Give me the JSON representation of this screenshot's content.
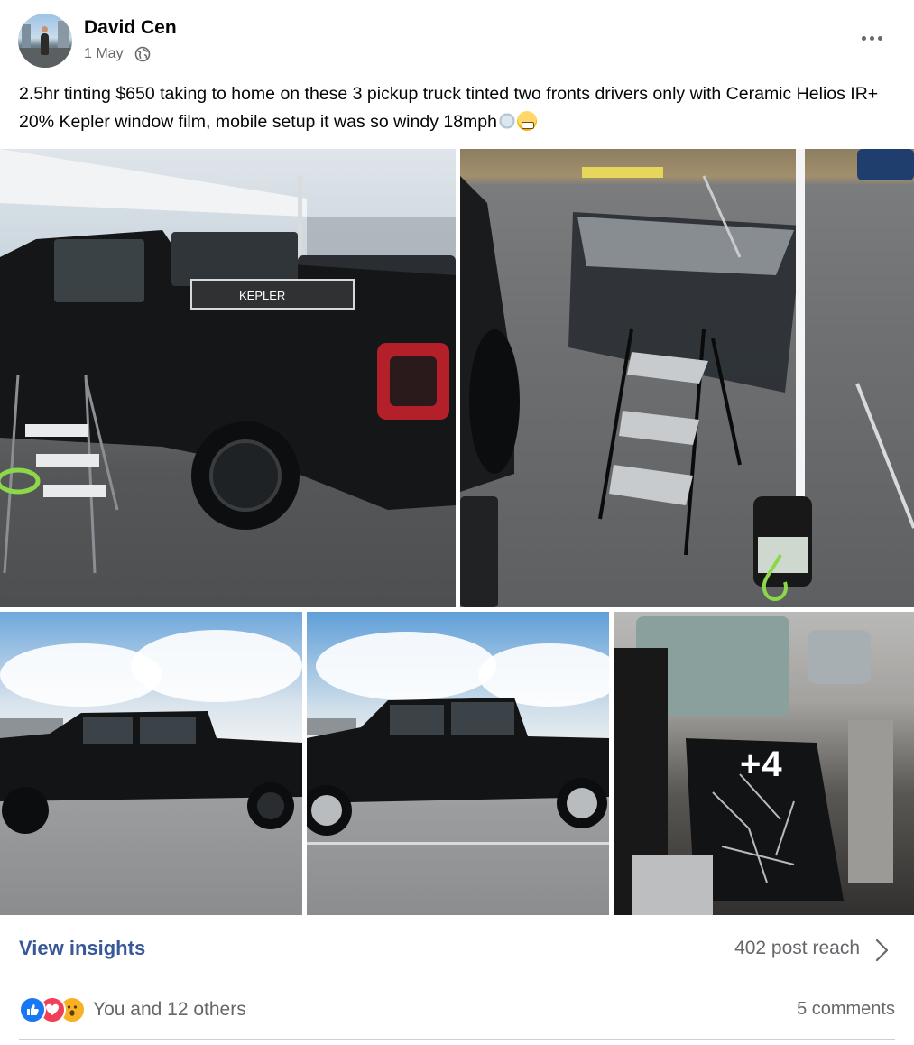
{
  "post": {
    "author": "David Cen",
    "date": "1 May",
    "audience_icon": "globe-icon",
    "text": "2.5hr tinting $650 taking to home on these 3 pickup truck tinted two fronts drivers only with Ceramic Helios IR+ 20% Kepler window film, mobile setup it was so windy 18mph",
    "text_emojis": [
      "dashing-away",
      "grimacing-face"
    ]
  },
  "photos": {
    "box_brand": "KEPLER",
    "extra_count": "+4"
  },
  "footer": {
    "insights_label": "View insights",
    "reach": "402 post reach",
    "reactions_label": "You and 12 others",
    "reaction_types": [
      "like",
      "love",
      "wow"
    ],
    "comments": "5 comments"
  },
  "colors": {
    "link": "#385898",
    "muted": "#65676b",
    "like": "#1877f2",
    "love": "#f33e58",
    "wow": "#f7b125"
  }
}
